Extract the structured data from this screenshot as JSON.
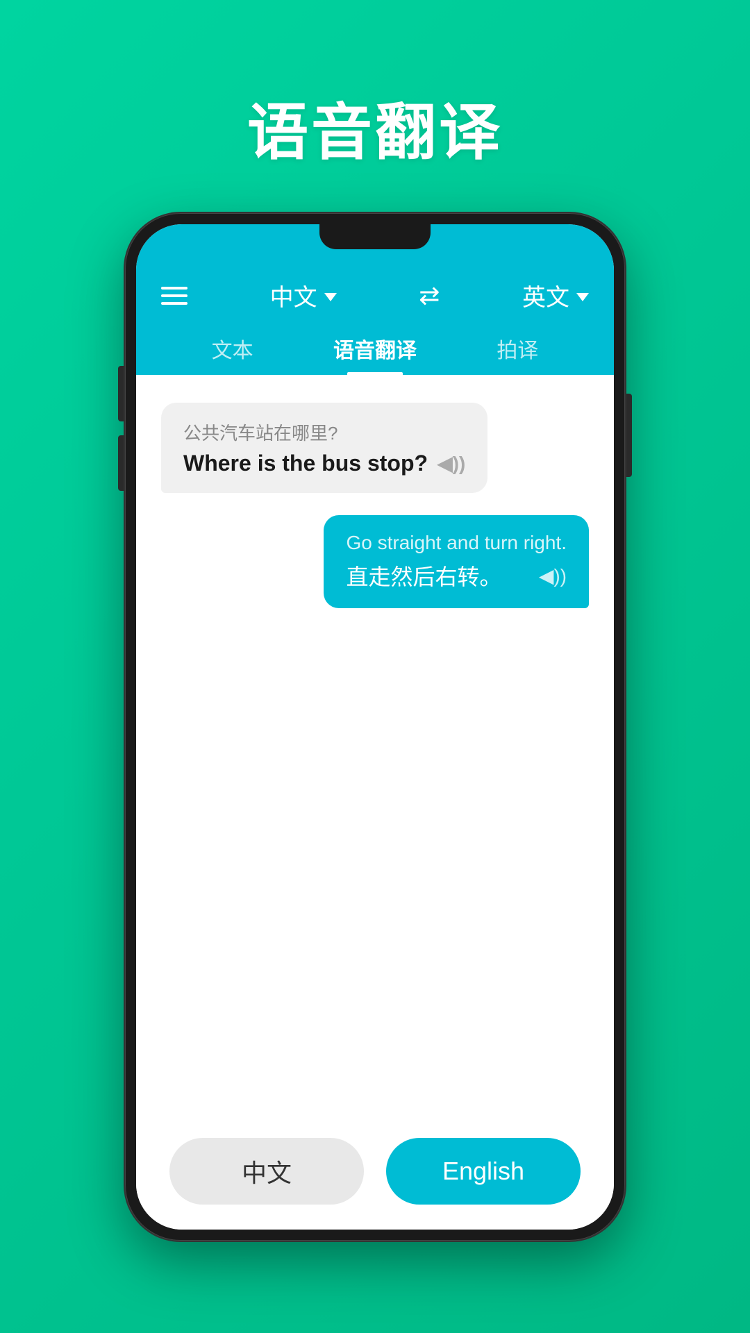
{
  "page": {
    "title": "语音翻译",
    "background_color": "#00c896"
  },
  "header": {
    "source_lang": "中文",
    "target_lang": "英文",
    "menu_label": "menu"
  },
  "tabs": [
    {
      "id": "text",
      "label": "文本",
      "active": false
    },
    {
      "id": "voice",
      "label": "语音翻译",
      "active": true
    },
    {
      "id": "photo",
      "label": "拍译",
      "active": false
    }
  ],
  "messages": [
    {
      "direction": "left",
      "original": "公共汽车站在哪里?",
      "translation": "Where is the bus stop?",
      "has_audio": true
    },
    {
      "direction": "right",
      "original": "Go straight and turn right.",
      "translation": "直走然后右转。",
      "has_audio": true
    }
  ],
  "bottom_buttons": {
    "chinese_label": "中文",
    "english_label": "English"
  },
  "icons": {
    "menu": "☰",
    "swap": "⇄",
    "sound": "◀))"
  }
}
